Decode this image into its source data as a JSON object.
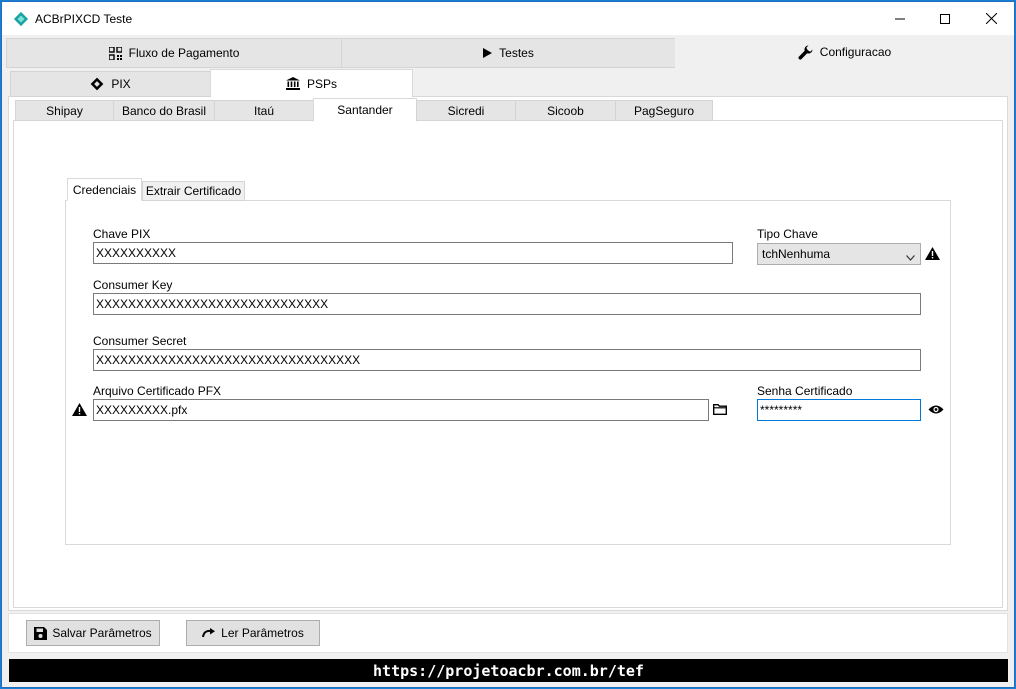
{
  "window": {
    "title": "ACBrPIXCD Teste",
    "icon": "acbr-diamond-icon",
    "accent": "#1aa3a3"
  },
  "main_tabs": [
    {
      "label": "Fluxo de Pagamento",
      "icon": "qrcode-icon"
    },
    {
      "label": "Testes",
      "icon": "play-icon"
    },
    {
      "label": "Configuracao",
      "icon": "wrench-icon",
      "active": true
    }
  ],
  "config_tabs": [
    {
      "label": "PIX",
      "icon": "pix-icon"
    },
    {
      "label": "PSPs",
      "icon": "bank-icon",
      "active": true
    }
  ],
  "psp_tabs": [
    "Shipay",
    "Banco do Brasil",
    "Itaú",
    "Santander",
    "Sicredi",
    "Sicoob",
    "PagSeguro"
  ],
  "psp_active": "Santander",
  "inner_tabs": [
    "Credenciais",
    "Extrair Certificado"
  ],
  "form": {
    "chave_pix_label": "Chave PIX",
    "chave_pix_value": "XXXXXXXXXX",
    "tipo_chave_label": "Tipo Chave",
    "tipo_chave_value": "tchNenhuma",
    "consumer_key_label": "Consumer Key",
    "consumer_key_value": "XXXXXXXXXXXXXXXXXXXXXXXXXXXXX",
    "consumer_secret_label": "Consumer Secret",
    "consumer_secret_value": "XXXXXXXXXXXXXXXXXXXXXXXXXXXXXXXXX",
    "arquivo_label": "Arquivo Certificado PFX",
    "arquivo_value": "XXXXXXXXX.pfx",
    "senha_label": "Senha Certificado",
    "senha_value": "*********"
  },
  "buttons": {
    "salvar": "Salvar Parâmetros",
    "ler": "Ler Parâmetros"
  },
  "footer_link": "https://projetoacbr.com.br/tef"
}
